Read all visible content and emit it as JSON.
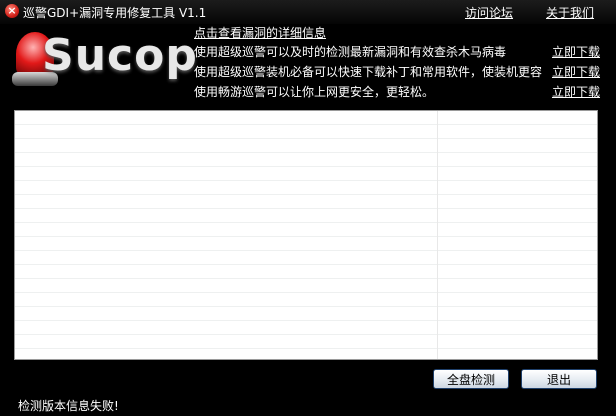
{
  "window": {
    "title": "巡警GDI+漏洞专用修复工具 V1.1",
    "close_icon": "close-icon",
    "links": {
      "forum": "访问论坛",
      "about": "关于我们"
    }
  },
  "banner": {
    "logo_text": "Sucop",
    "info_link": "点击查看漏洞的详细信息",
    "lines": [
      "使用超级巡警可以及时的检测最新漏洞和有效查杀木马病毒",
      "使用超级巡警装机必备可以快速下载补丁和常用软件，使装机更容",
      "使用畅游巡警可以让你上网更安全，更轻松。"
    ],
    "download_label": "立即下载"
  },
  "buttons": {
    "scan": "全盘检测",
    "exit": "退出"
  },
  "status": "检测版本信息失败!",
  "colors": {
    "background": "#000000",
    "panel": "#ffffff",
    "accent_red": "#e21919",
    "button_border": "#1e3f6a"
  }
}
